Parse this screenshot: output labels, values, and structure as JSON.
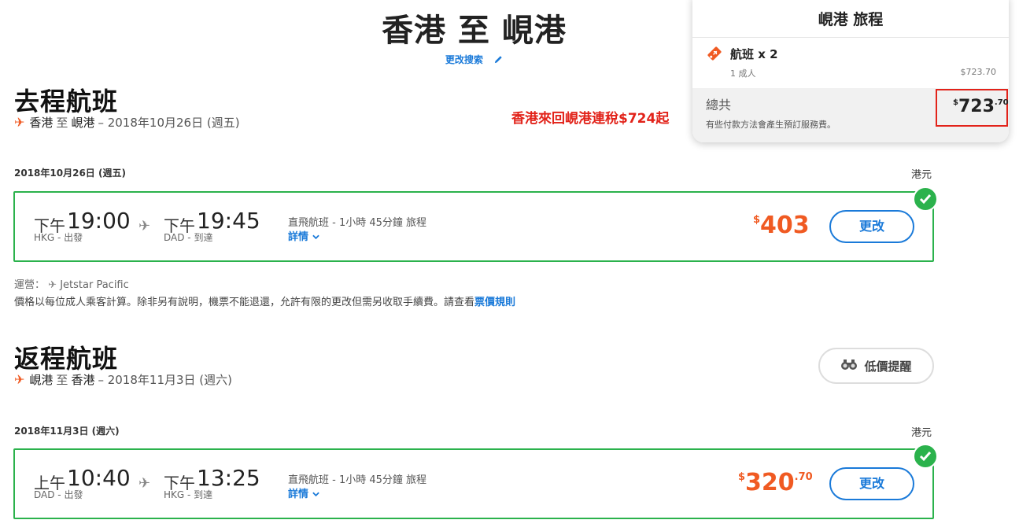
{
  "header": {
    "title": "香港 至 峴港",
    "modify_label": "更改搜索"
  },
  "promo": "香港來回峴港連稅$724起",
  "outbound": {
    "title": "去程航班",
    "route_from": "香港",
    "route_to_word": "至",
    "route_to": "峴港",
    "route_date": "– 2018年10月26日 (週五)",
    "date_label": "2018年10月26日 (週五)",
    "currency": "港元",
    "dep_prefix": "下午",
    "dep_time": "19:00",
    "dep_code": "HKG - 出發",
    "arr_prefix": "下午",
    "arr_time": "19:45",
    "arr_code": "DAD - 到達",
    "info": "直飛航班 - 1小時 45分鐘 旅程",
    "details_label": "詳情",
    "price_symbol": "$",
    "price": "403",
    "price_cents": "",
    "change_label": "更改",
    "operator_label": "運營：",
    "operator_name": "Jetstar Pacific",
    "policy_text": "價格以每位成人乘客計算。除非另有說明，機票不能退還，允許有限的更改但需另收取手續費。請查看",
    "policy_link": "票價規則"
  },
  "inbound": {
    "title": "返程航班",
    "route_from": "峴港",
    "route_to_word": "至",
    "route_to": "香港",
    "route_date": "– 2018年11月3日 (週六)",
    "date_label": "2018年11月3日 (週六)",
    "currency": "港元",
    "alert_label": "低價提醒",
    "dep_prefix": "上午",
    "dep_time": "10:40",
    "dep_code": "DAD - 出發",
    "arr_prefix": "下午",
    "arr_time": "13:25",
    "arr_code": "HKG - 到達",
    "info": "直飛航班 - 1小時 45分鐘 旅程",
    "details_label": "詳情",
    "price_symbol": "$",
    "price": "320",
    "price_cents": ".70",
    "change_label": "更改"
  },
  "summary": {
    "title": "峴港 旅程",
    "item_label": "航班 x 2",
    "passengers": "1 成人",
    "item_price": "$723.70",
    "total_label": "總共",
    "total_symbol": "$",
    "total_price": "723",
    "total_cents": ".70",
    "fee_note": "有些付款方法會產生預訂服務費。"
  },
  "colors": {
    "accent_orange": "#f05a22",
    "link_blue": "#1a7ad9",
    "selected_green": "#2bb24c",
    "promo_red": "#e2231a"
  },
  "icons": [
    "plane-icon",
    "pencil-icon",
    "chevron-down-icon",
    "check-icon",
    "binoculars-icon",
    "ticket-icon"
  ]
}
